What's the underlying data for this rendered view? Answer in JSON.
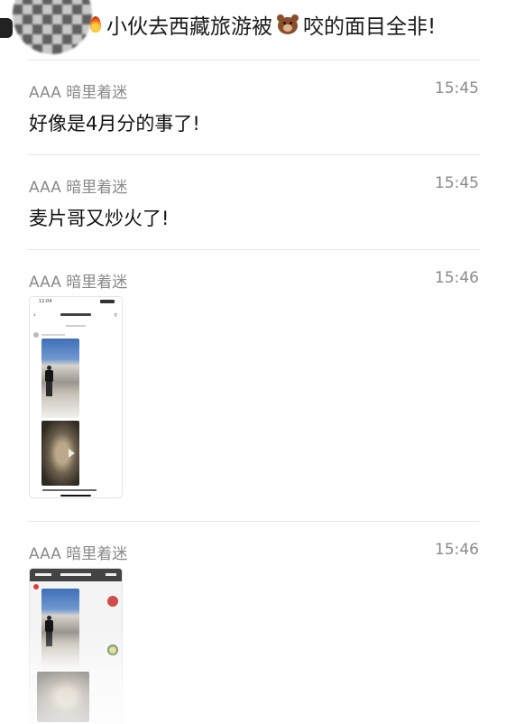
{
  "header": {
    "title_prefix": "小伙去西藏旅游被",
    "title_suffix": "咬的面目全非!",
    "title_icon": "bear-icon",
    "leading_icon": "fire-icon"
  },
  "messages": [
    {
      "sender": "AAA 暗里着迷",
      "time": "15:45",
      "text": "好像是4月分的事了!"
    },
    {
      "sender": "AAA 暗里着迷",
      "time": "15:45",
      "text": "麦片哥又炒火了!"
    },
    {
      "sender": "AAA 暗里着迷",
      "time": "15:46",
      "image": "screenshot-thumbnail"
    },
    {
      "sender": "AAA 暗里着迷",
      "time": "15:46",
      "image": "screenshot-thumbnail"
    }
  ]
}
